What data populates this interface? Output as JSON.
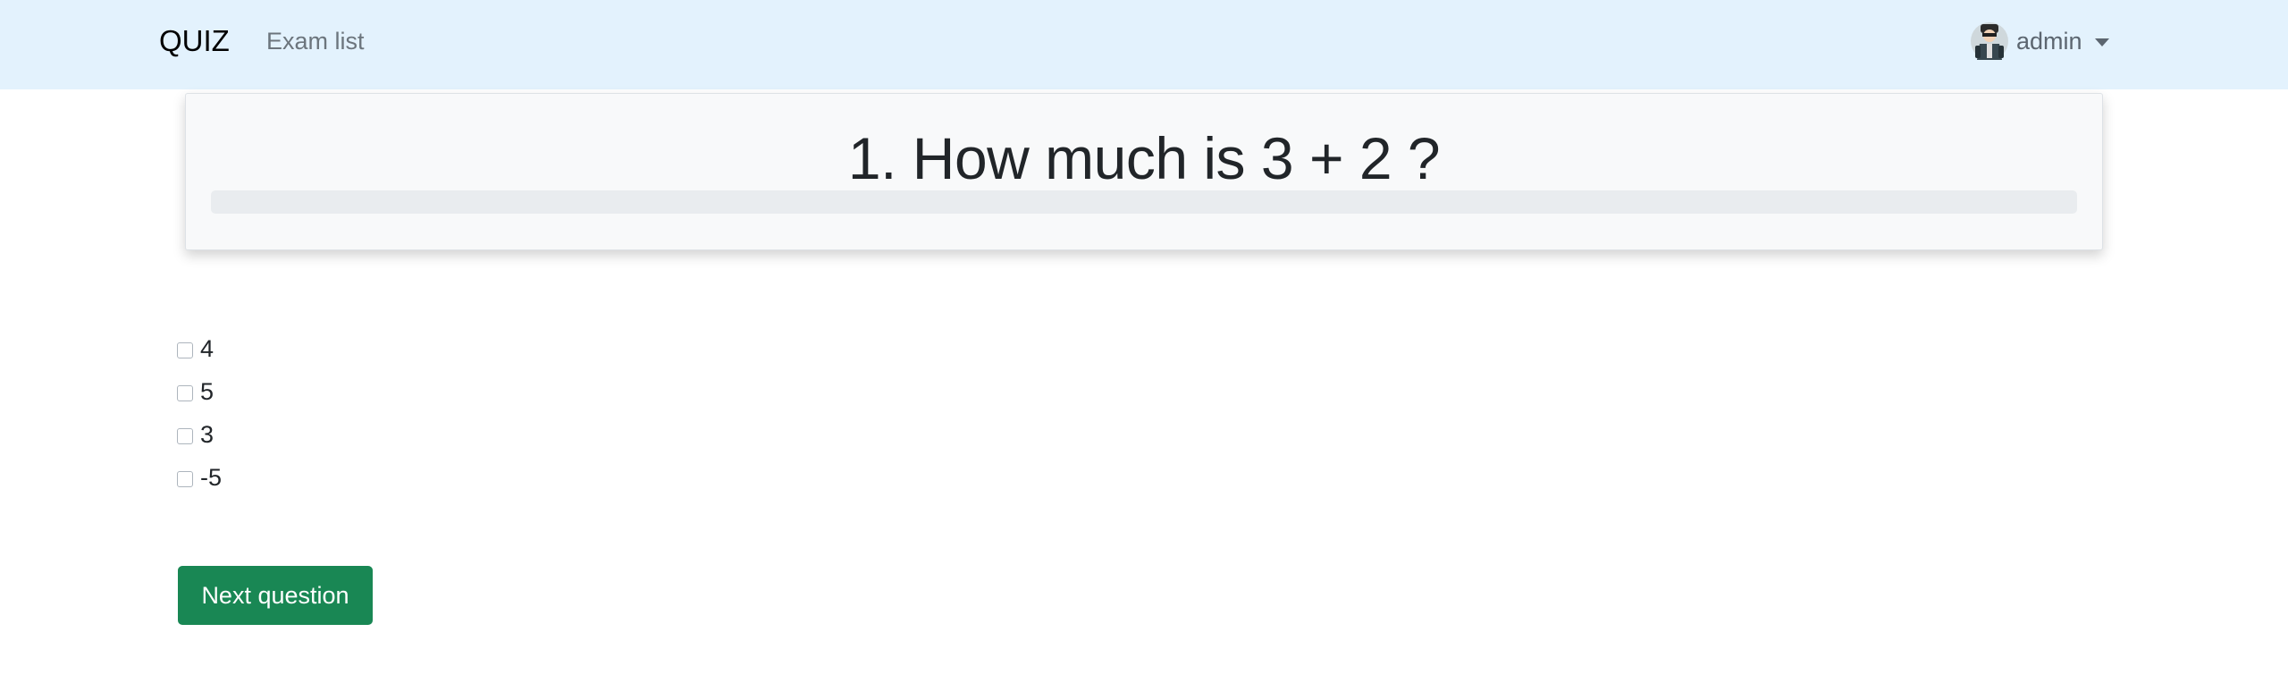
{
  "navbar": {
    "brand": "QUIZ",
    "links": [
      {
        "label": "Exam list"
      }
    ],
    "user": {
      "name": "admin",
      "avatar_icon": "user-avatar-icon"
    },
    "background_color": "#e3f2fd"
  },
  "question": {
    "title": "1. How much is 3 + 2 ?",
    "progress_fraction": 0
  },
  "answers": [
    {
      "label": "4",
      "checked": false
    },
    {
      "label": "5",
      "checked": false
    },
    {
      "label": "3",
      "checked": false
    },
    {
      "label": "-5",
      "checked": false
    }
  ],
  "actions": {
    "next_label": "Next question",
    "next_color": "#198754"
  }
}
